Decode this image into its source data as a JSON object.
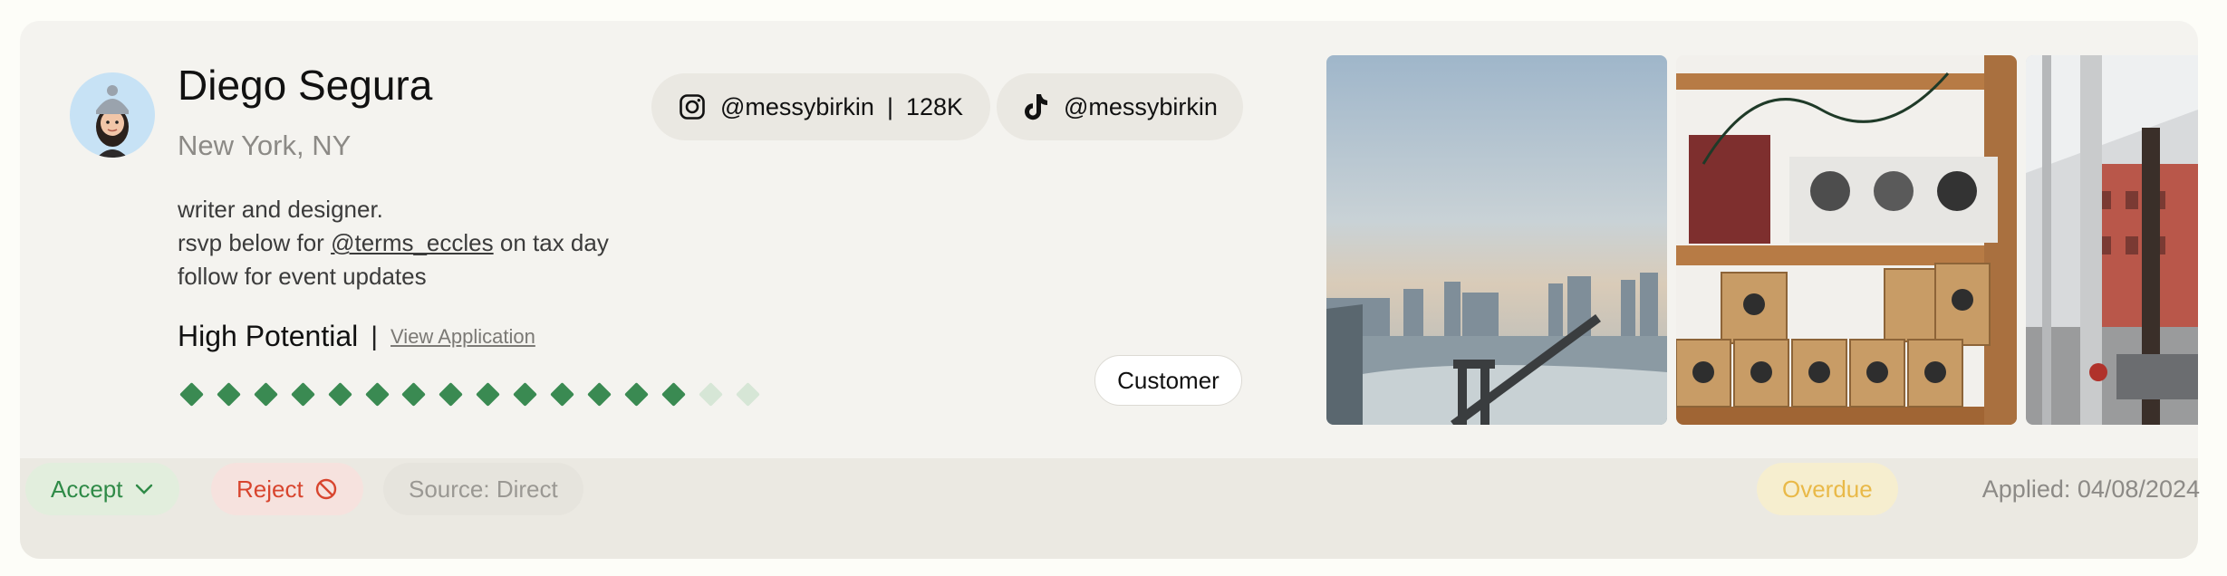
{
  "profile": {
    "name": "Diego Segura",
    "location": "New York, NY",
    "bio": {
      "line1": "writer and designer.",
      "line2_prefix": "rsvp below for",
      "line2_mention": "@terms_eccles",
      "line2_suffix": "on tax day",
      "line3": "follow for event updates"
    },
    "potential_label": "High Potential",
    "potential_sep": "|",
    "view_application": "View Application",
    "rating": {
      "filled": 14,
      "total": 16
    }
  },
  "socials": {
    "instagram": {
      "icon": "instagram-icon",
      "handle": "@messybirkin",
      "sep": "|",
      "followers": "128K"
    },
    "tiktok": {
      "icon": "tiktok-icon",
      "handle": "@messybirkin"
    }
  },
  "tag": "Customer",
  "photos": [
    "brooklyn-bridge-skyline",
    "stamp-shelf",
    "street-scaffolding"
  ],
  "footer": {
    "accept": "Accept",
    "reject": "Reject",
    "source": "Source: Direct",
    "overdue": "Overdue",
    "applied": "Applied: 04/08/2024"
  },
  "colors": {
    "card_bg": "#f4f3ef",
    "footer_bg": "#ebe9e2",
    "accept": "#2f8a47",
    "reject": "#d8452e",
    "overdue": "#e9b948",
    "rating_filled": "#3a8a52",
    "rating_empty": "#d6e6d6"
  }
}
